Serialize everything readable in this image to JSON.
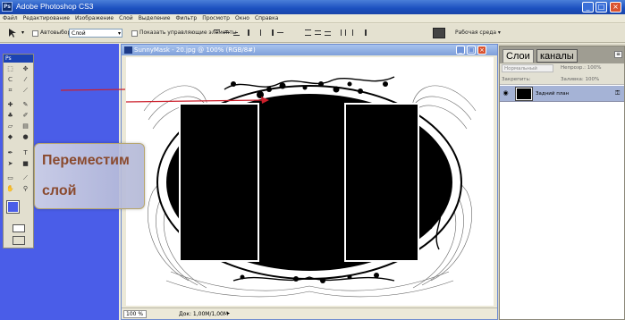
{
  "app": {
    "title": "Adobe Photoshop CS3",
    "logo": "Ps"
  },
  "window_buttons": {
    "minimize": "_",
    "restore": "□",
    "close": "×"
  },
  "menu": [
    "Файл",
    "Редактирование",
    "Изображение",
    "Слой",
    "Выделение",
    "Фильтр",
    "Просмотр",
    "Окно",
    "Справка"
  ],
  "options": {
    "autoselect_label": "Автовыбор:",
    "autoselect_value": "Слой",
    "show_controls_label": "Показать управляющие элементы",
    "workspace_label": "Рабочая среда ▾"
  },
  "toolbox": {
    "header": "Ps"
  },
  "document": {
    "title": "SunnyMask - 20.jpg @ 100% (RGB/8#)",
    "zoom": "100 %",
    "doc_size": "Док: 1,00M/1,00M"
  },
  "layers_panel": {
    "tabs": [
      "Слои",
      "каналы"
    ],
    "blend_mode": "Нормальный",
    "opacity_label": "Непрозр.: 100%",
    "lock_label": "Закрепить:",
    "fill_label": "Заливка: 100%",
    "layer_name": "Задний план"
  },
  "callout": {
    "line1": "Переместим",
    "line2": "слой"
  },
  "colors": {
    "accent_blue": "#4a5de8",
    "arrow_red": "#cc1f2b",
    "callout_text": "#8a4a2e",
    "title_blue": "#1b4fbf"
  },
  "icons": [
    "move-tool-icon",
    "marquee-tool-icon",
    "lasso-tool-icon",
    "crop-tool-icon",
    "brush-tool-icon",
    "eraser-tool-icon",
    "text-tool-icon",
    "eye-icon",
    "lock-icon",
    "panel-menu-icon"
  ]
}
